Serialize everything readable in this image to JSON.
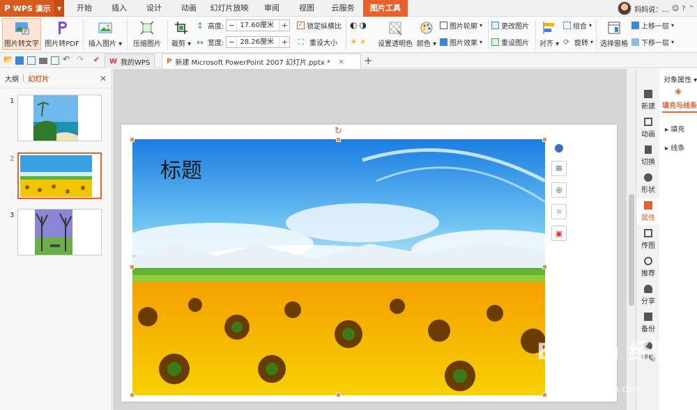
{
  "app": {
    "name": "WPS 演示",
    "logo_letter": "P"
  },
  "menu": {
    "tabs": [
      "开始",
      "插入",
      "设计",
      "动画",
      "幻灯片放映",
      "审阅",
      "视图",
      "云服务",
      "图片工具"
    ],
    "active_tab": "图片工具"
  },
  "user": {
    "name": "妈妈说：..."
  },
  "ribbon": {
    "pic_to_text": "图片转文字",
    "pic_to_pdf": "图片转PDF",
    "insert_picture": "插入图片",
    "compress_picture": "压缩图片",
    "crop": "裁剪",
    "height_label": "高度:",
    "height_value": "17.60厘米",
    "width_label": "宽度:",
    "width_value": "28.26厘米",
    "lock_ratio": "锁定纵横比",
    "reset_size": "重设大小",
    "set_transparent": "设置透明色",
    "color": "颜色",
    "outline": "图片轮廓",
    "effects": "图片效果",
    "change_picture": "更改图片",
    "reset_picture": "重设图片",
    "align": "对齐",
    "group": "组合",
    "rotate": "旋转",
    "selection_pane": "选择窗格",
    "bring_forward": "上移一层",
    "send_backward": "下移一层"
  },
  "doctabs": [
    {
      "label": "我的WPS",
      "active": false
    },
    {
      "label": "新建 Microsoft PowerPoint 2007 幻灯片.pptx *",
      "active": true
    }
  ],
  "leftpanel": {
    "outline_tab": "大纲",
    "slides_tab": "幻灯片",
    "slides": [
      {
        "num": "1",
        "active": false
      },
      {
        "num": "2",
        "active": true
      },
      {
        "num": "3",
        "active": false
      }
    ]
  },
  "slide": {
    "title": "标题"
  },
  "sidebar": {
    "items": [
      "新建",
      "动画",
      "切换",
      "形状",
      "属性",
      "传图",
      "推荐",
      "分享",
      "备份",
      "帮助"
    ],
    "active": "属性"
  },
  "properties": {
    "header": "对象属性",
    "tab": "填充与线条",
    "sections": [
      "填充",
      "线条"
    ]
  },
  "watermark": {
    "main": "Bai du 经验",
    "sub": "jingyan.baidu.com"
  },
  "colors": {
    "accent": "#e8612c",
    "app_button": "#d75a1f",
    "handle": "#f08a4b"
  }
}
